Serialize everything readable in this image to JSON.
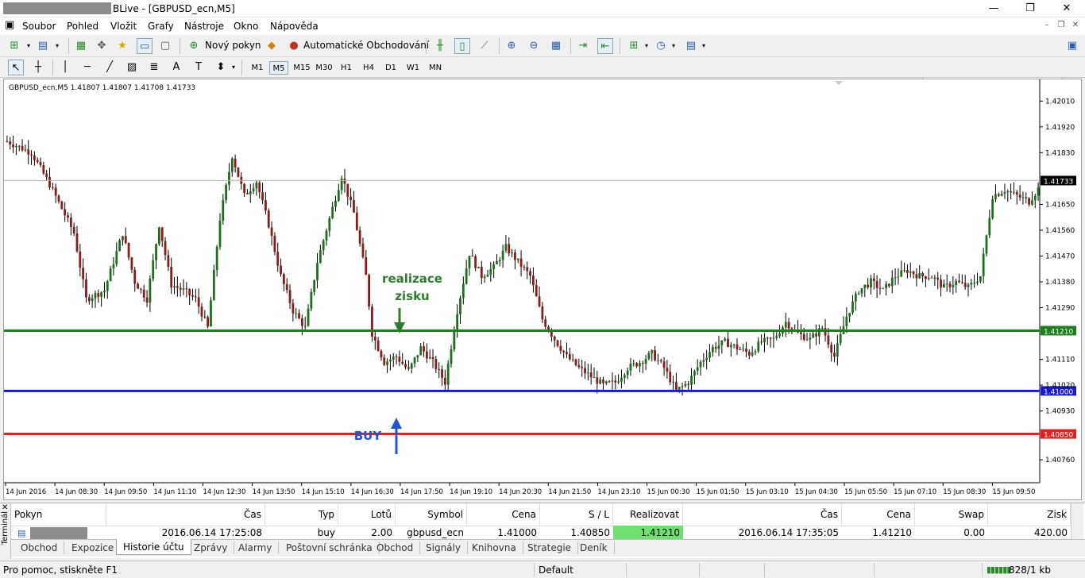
{
  "window": {
    "title": "BLive - [GBPUSD_ecn,M5]",
    "minimize": "—",
    "maximize": "❐",
    "close": "✕"
  },
  "menu": [
    "Soubor",
    "Pohled",
    "Vložit",
    "Grafy",
    "Nástroje",
    "Okno",
    "Nápověda"
  ],
  "toolbar": {
    "new_order": "Nový pokyn",
    "auto_trading": "Automatické Obchodování"
  },
  "timeframes": [
    "M1",
    "M5",
    "M15",
    "M30",
    "H1",
    "H4",
    "D1",
    "W1",
    "MN"
  ],
  "active_timeframe": "M5",
  "search": {
    "placeholder": ""
  },
  "chart_info": "GBPUSD_ecn,M5  1.41807 1.41807 1.41708 1.41733",
  "chart_data": {
    "type": "candlestick",
    "symbol": "GBPUSD_ecn",
    "timeframe": "M5",
    "ylim": [
      1.4068,
      1.4208
    ],
    "y_ticks": [
      "1.42010",
      "1.41920",
      "1.41830",
      "1.41650",
      "1.41560",
      "1.41470",
      "1.41380",
      "1.41290",
      "1.41110",
      "1.41020",
      "1.40930",
      "1.40760"
    ],
    "x_ticks": [
      "14 Jun 2016",
      "14 Jun 08:30",
      "14 Jun 09:50",
      "14 Jun 11:10",
      "14 Jun 12:30",
      "14 Jun 13:50",
      "14 Jun 15:10",
      "14 Jun 16:30",
      "14 Jun 17:50",
      "14 Jun 19:10",
      "14 Jun 20:30",
      "14 Jun 21:50",
      "14 Jun 23:10",
      "15 Jun 00:30",
      "15 Jun 01:50",
      "15 Jun 03:10",
      "15 Jun 04:30",
      "15 Jun 05:50",
      "15 Jun 07:10",
      "15 Jun 08:30",
      "15 Jun 09:50"
    ],
    "price_profile": [
      [
        0,
        1.4187
      ],
      [
        8,
        1.4183
      ],
      [
        14,
        1.4172
      ],
      [
        22,
        1.4155
      ],
      [
        26,
        1.4132
      ],
      [
        32,
        1.4135
      ],
      [
        38,
        1.4155
      ],
      [
        42,
        1.4138
      ],
      [
        46,
        1.4132
      ],
      [
        50,
        1.4158
      ],
      [
        54,
        1.4137
      ],
      [
        58,
        1.4135
      ],
      [
        62,
        1.4132
      ],
      [
        66,
        1.4122
      ],
      [
        70,
        1.416
      ],
      [
        74,
        1.4182
      ],
      [
        78,
        1.4168
      ],
      [
        82,
        1.4173
      ],
      [
        86,
        1.4158
      ],
      [
        90,
        1.414
      ],
      [
        94,
        1.4128
      ],
      [
        98,
        1.4122
      ],
      [
        102,
        1.4145
      ],
      [
        106,
        1.416
      ],
      [
        110,
        1.4175
      ],
      [
        114,
        1.4162
      ],
      [
        118,
        1.414
      ],
      [
        120,
        1.412
      ],
      [
        124,
        1.411
      ],
      [
        128,
        1.4112
      ],
      [
        132,
        1.4107
      ],
      [
        136,
        1.4115
      ],
      [
        140,
        1.411
      ],
      [
        144,
        1.4103
      ],
      [
        148,
        1.4128
      ],
      [
        152,
        1.4148
      ],
      [
        156,
        1.414
      ],
      [
        160,
        1.4143
      ],
      [
        164,
        1.415
      ],
      [
        168,
        1.4145
      ],
      [
        172,
        1.414
      ],
      [
        176,
        1.4125
      ],
      [
        180,
        1.4118
      ],
      [
        184,
        1.4112
      ],
      [
        188,
        1.4108
      ],
      [
        192,
        1.4105
      ],
      [
        196,
        1.4102
      ],
      [
        200,
        1.4103
      ],
      [
        204,
        1.4108
      ],
      [
        208,
        1.411
      ],
      [
        212,
        1.4113
      ],
      [
        216,
        1.4108
      ],
      [
        220,
        1.41
      ],
      [
        224,
        1.4103
      ],
      [
        228,
        1.411
      ],
      [
        232,
        1.4115
      ],
      [
        236,
        1.4117
      ],
      [
        240,
        1.4115
      ],
      [
        244,
        1.4113
      ],
      [
        248,
        1.4117
      ],
      [
        252,
        1.4118
      ],
      [
        256,
        1.4124
      ],
      [
        260,
        1.412
      ],
      [
        264,
        1.4118
      ],
      [
        268,
        1.4122
      ],
      [
        272,
        1.4112
      ],
      [
        276,
        1.4126
      ],
      [
        280,
        1.4135
      ],
      [
        284,
        1.4138
      ],
      [
        288,
        1.4135
      ],
      [
        292,
        1.414
      ],
      [
        296,
        1.4142
      ],
      [
        300,
        1.414
      ],
      [
        304,
        1.414
      ],
      [
        308,
        1.4136
      ],
      [
        312,
        1.4138
      ],
      [
        316,
        1.4136
      ],
      [
        320,
        1.414
      ],
      [
        324,
        1.4168
      ],
      [
        328,
        1.417
      ],
      [
        332,
        1.4168
      ],
      [
        336,
        1.4166
      ],
      [
        340,
        1.4172
      ]
    ],
    "lines": [
      {
        "name": "take-profit",
        "price": 1.4121,
        "label": "1.41210",
        "color": "#1e7e1e"
      },
      {
        "name": "buy",
        "price": 1.41,
        "label": "1.41000",
        "color": "#1a1acc"
      },
      {
        "name": "stop-loss",
        "price": 1.4085,
        "label": "1.40850",
        "color": "#dd2222"
      }
    ],
    "current_price": {
      "value": 1.41733,
      "label": "1.41733"
    },
    "annotations": [
      {
        "name": "take-profit-note",
        "text": "realizace zisku",
        "color": "#2e7d2e"
      },
      {
        "name": "buy-note",
        "text": "BUY",
        "color": "#1a56d6"
      }
    ]
  },
  "terminal": {
    "label": "Terminál",
    "columns": [
      "Pokyn",
      "Čas",
      "Typ",
      "Lotů",
      "Symbol",
      "Cena",
      "S / L",
      "Realizovat zisk",
      "Čas",
      "Cena",
      "Swap",
      "Zisk"
    ],
    "row": {
      "order": "",
      "open_time": "2016.06.14 17:25:08",
      "type": "buy",
      "lots": "2.00",
      "symbol": "gbpusd_ecn",
      "price": "1.41000",
      "sl": "1.40850",
      "tp": "1.41210",
      "close_time": "2016.06.14 17:35:05",
      "close_price": "1.41210",
      "swap": "0.00",
      "profit": "420.00"
    }
  },
  "tabs": [
    "Obchod",
    "Expozice",
    "Historie účtu",
    "Zprávy",
    "Alarmy",
    "Poštovní schránka",
    "Obchod",
    "Signály",
    "Knihovna",
    "Strategie",
    "Deník"
  ],
  "active_tab": "Historie účtu",
  "status": {
    "help": "Pro pomoc, stiskněte F1",
    "profile": "Default",
    "traffic": "828/1 kb"
  }
}
